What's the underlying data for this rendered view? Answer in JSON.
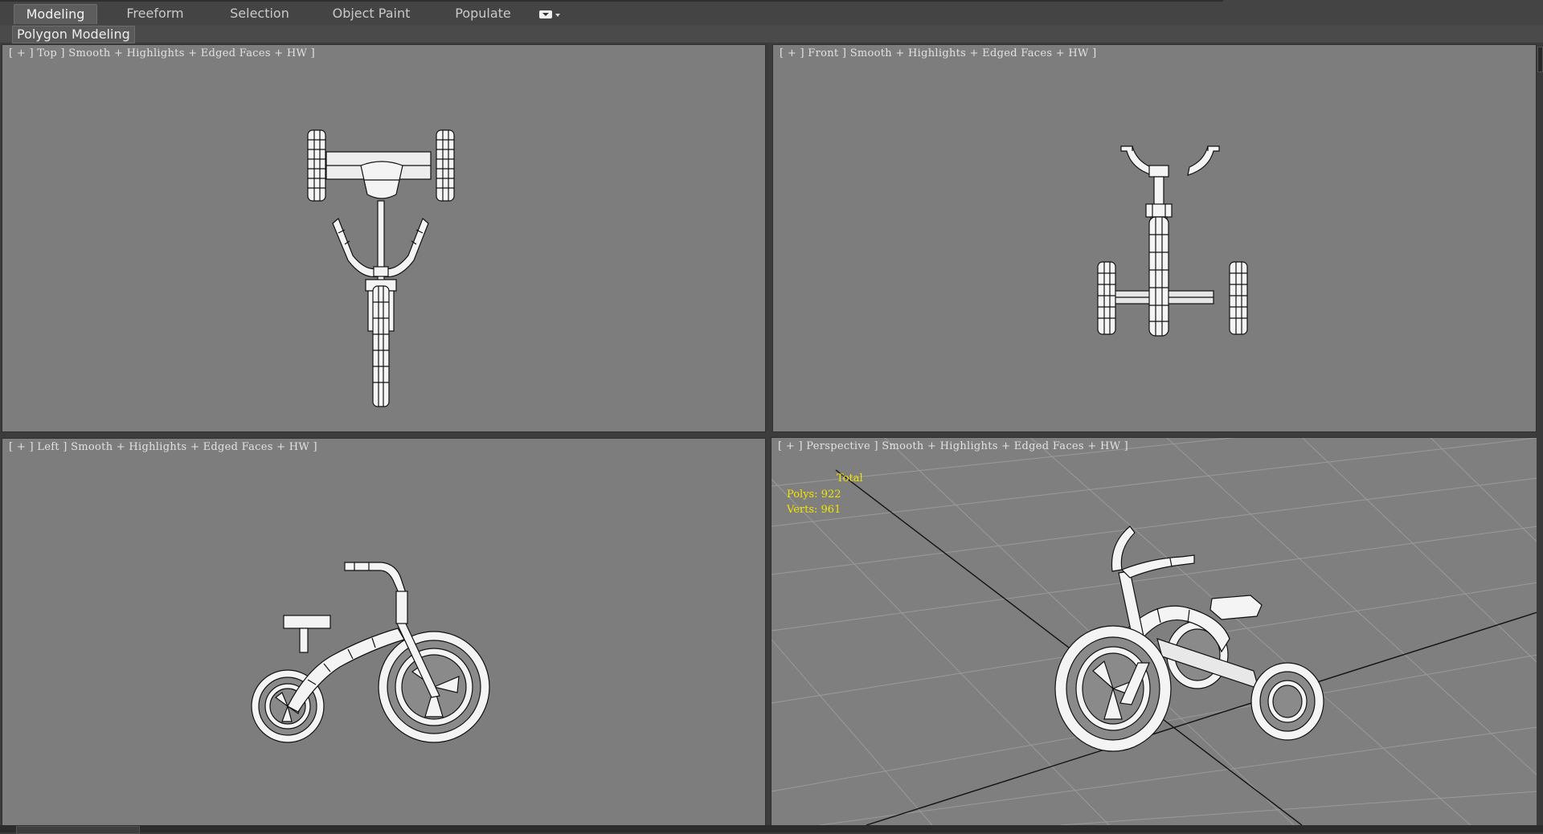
{
  "ribbon": {
    "tabs": [
      {
        "label": "Modeling",
        "active": true
      },
      {
        "label": "Freeform",
        "active": false
      },
      {
        "label": "Selection",
        "active": false
      },
      {
        "label": "Object Paint",
        "active": false
      },
      {
        "label": "Populate",
        "active": false
      }
    ],
    "dropdown_icon": "options-dropdown-icon",
    "subtab": "Polygon Modeling"
  },
  "viewports": {
    "top": {
      "plus": "+",
      "view": "Top",
      "shading": "Smooth + Highlights + Edged Faces + HW"
    },
    "front": {
      "plus": "+",
      "view": "Front",
      "shading": "Smooth + Highlights + Edged Faces + HW"
    },
    "left": {
      "plus": "+",
      "view": "Left",
      "shading": "Smooth + Highlights + Edged Faces + HW"
    },
    "perspective": {
      "plus": "+",
      "view": "Perspective",
      "shading": "Smooth + Highlights + Edged Faces + HW",
      "stats": {
        "header": "Total",
        "polys_label": "Polys:",
        "polys": "922",
        "verts_label": "Verts:",
        "verts": "961"
      }
    }
  },
  "colors": {
    "viewport_bg": "#7d7d7d",
    "stats_text": "#f3e400",
    "label_text": "#e2e2e2",
    "model_fill": "#f4f4f4",
    "wire": "#111111"
  },
  "model_name": "tricycle"
}
